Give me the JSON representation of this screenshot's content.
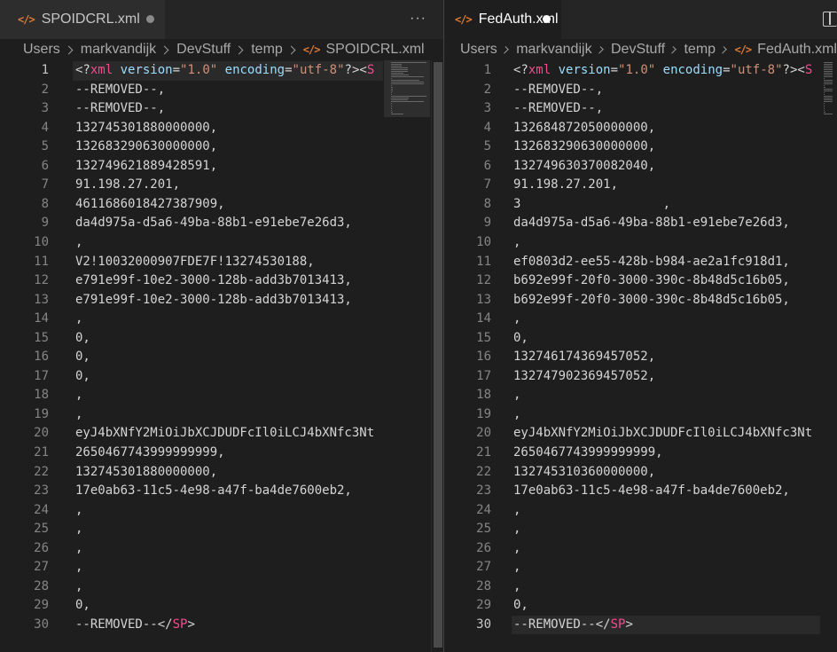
{
  "left": {
    "tab": {
      "icon": "</>",
      "label": "SPOIDCRL.xml",
      "state": "modified-dot-icon"
    },
    "more_label": "···",
    "breadcrumb": [
      "Users",
      "markvandijk",
      "DevStuff",
      "temp",
      "SPOIDCRL.xml"
    ],
    "lines": [
      "",
      "--REMOVED--,",
      "--REMOVED--,",
      "132745301880000000,",
      "132683290630000000,",
      "132749621889428591,",
      "91.198.27.201,",
      "4611686018427387909,",
      "da4d975a-d5a6-49ba-88b1-e91ebe7e26d3,",
      ",",
      "V2!10032000907FDE7F!13274530188,",
      "e791e99f-10e2-3000-128b-add3b7013413,",
      "e791e99f-10e2-3000-128b-add3b7013413,",
      ",",
      "0,",
      "0,",
      "0,",
      ",",
      ",",
      "eyJ4bXNfY2MiOiJbXCJDUDFcIl0iLCJ4bXNfc3Nt",
      "2650467743999999999,",
      "132745301880000000,",
      "17e0ab63-11c5-4e98-a47f-ba4de7600eb2,",
      ",",
      ",",
      ",",
      ",",
      ",",
      "0,",
      ""
    ],
    "first_line": {
      "open": "<?",
      "tag": "xml",
      "attr1": "version",
      "eq1": "=",
      "val1": "\"1.0\"",
      "attr2": "encoding",
      "eq2": "=",
      "val2": "\"utf-8\"",
      "close": "?><",
      "tag2": "S"
    },
    "last_line": {
      "text": "--REMOVED--",
      "open": "</",
      "tag": "SP",
      "close": ">"
    }
  },
  "right": {
    "tab": {
      "icon": "</>",
      "label": "FedAuth.xml",
      "state": "unsaved-dot-icon"
    },
    "split_icon": "split-editor-icon",
    "breadcrumb": [
      "Users",
      "markvandijk",
      "DevStuff",
      "temp",
      "FedAuth.xml"
    ],
    "lines": [
      "",
      "--REMOVED--,",
      "--REMOVED--,",
      "132684872050000000,",
      "132683290630000000,",
      "132749630370082040,",
      "91.198.27.201,",
      "3                   ,",
      "da4d975a-d5a6-49ba-88b1-e91ebe7e26d3,",
      ",",
      "ef0803d2-ee55-428b-b984-ae2a1fc918d1,",
      "b692e99f-20f0-3000-390c-8b48d5c16b05,",
      "b692e99f-20f0-3000-390c-8b48d5c16b05,",
      ",",
      "0,",
      "132746174369457052,",
      "132747902369457052,",
      ",",
      ",",
      "eyJ4bXNfY2MiOiJbXCJDUDFcIl0iLCJ4bXNfc3Nt",
      "2650467743999999999,",
      "132745310360000000,",
      "17e0ab63-11c5-4e98-a47f-ba4de7600eb2,",
      ",",
      ",",
      ",",
      ",",
      ",",
      "0,",
      ""
    ],
    "first_line": {
      "open": "<?",
      "tag": "xml",
      "attr1": "version",
      "eq1": "=",
      "val1": "\"1.0\"",
      "attr2": "encoding",
      "eq2": "=",
      "val2": "\"utf-8\"",
      "close": "?><",
      "tag2": "S"
    },
    "last_line": {
      "text": "--REMOVED--",
      "open": "</",
      "tag": "SP",
      "close": ">"
    }
  },
  "line_numbers": [
    "1",
    "2",
    "3",
    "4",
    "5",
    "6",
    "7",
    "8",
    "9",
    "10",
    "11",
    "12",
    "13",
    "14",
    "15",
    "16",
    "17",
    "18",
    "19",
    "20",
    "21",
    "22",
    "23",
    "24",
    "25",
    "26",
    "27",
    "28",
    "29",
    "30"
  ],
  "colors": {
    "background": "#1e1e1e",
    "tag": "#f14c8c",
    "attribute": "#9cdcfe",
    "string": "#ce9178",
    "file_icon": "#e37933"
  }
}
